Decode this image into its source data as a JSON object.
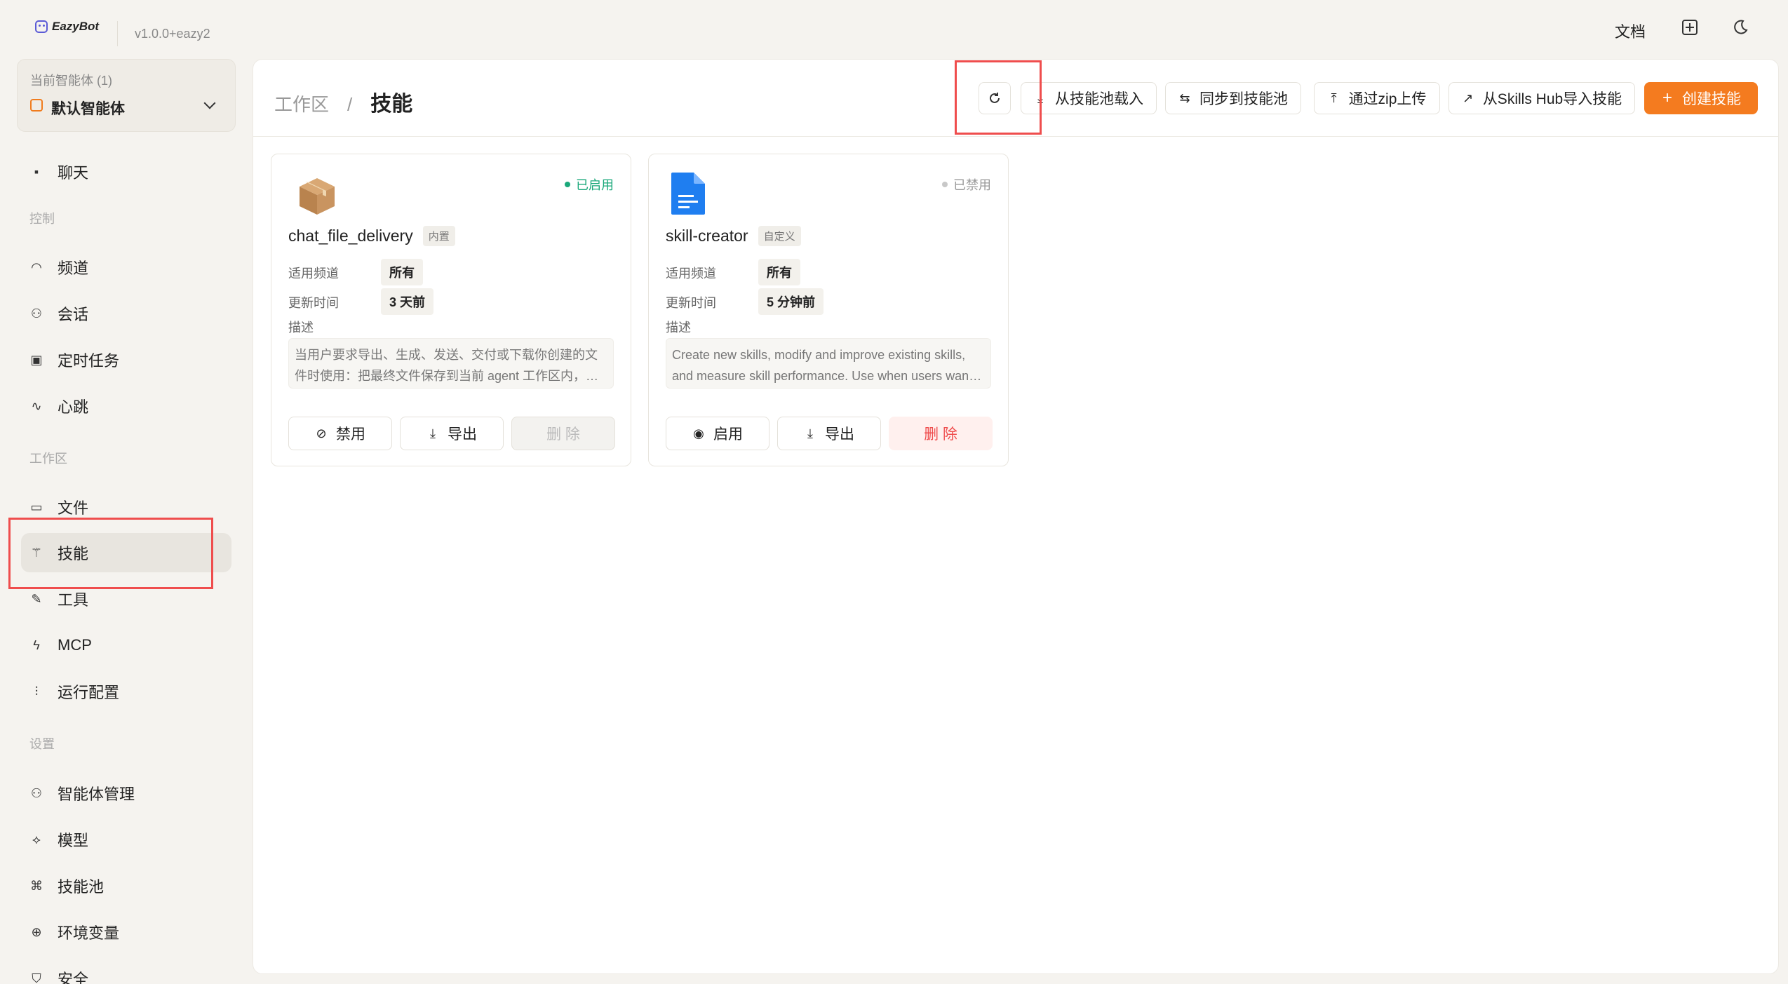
{
  "app": {
    "name": "EazyBot",
    "version": "v1.0.0+eazy2"
  },
  "topbar": {
    "docs_label": "文档",
    "layout_icon": "layout-icon",
    "theme_icon": "moon-icon"
  },
  "agent": {
    "label": "当前智能体 (1)",
    "name": "默认智能体"
  },
  "sidebar": {
    "chat": "聊天",
    "sections": {
      "control": "控制",
      "workspace": "工作区",
      "settings": "设置"
    },
    "control_items": [
      "频道",
      "会话",
      "定时任务",
      "心跳"
    ],
    "workspace_items": [
      "文件",
      "技能",
      "工具",
      "MCP",
      "运行配置"
    ],
    "settings_items": [
      "智能体管理",
      "模型",
      "技能池",
      "环境变量",
      "安全"
    ]
  },
  "breadcrumb": {
    "parent": "工作区",
    "separator": "/",
    "current": "技能"
  },
  "toolbar": {
    "load_from_pool": "从技能池载入",
    "sync_to_pool": "同步到技能池",
    "upload_zip": "通过zip上传",
    "import_hub": "从Skills Hub导入技能",
    "create": "创建技能"
  },
  "skills": [
    {
      "name": "chat_file_delivery",
      "tag": "内置",
      "status": "已启用",
      "status_color": "#1aa87a",
      "channel_label": "适用频道",
      "channel": "所有",
      "updated_label": "更新时间",
      "updated": "3 天前",
      "desc_label": "描述",
      "description": "当用户要求导出、生成、发送、交付或下载你创建的文件时使用：把最终文件保存到当前 agent 工作区内，并…",
      "toggle_label": "禁用",
      "export_label": "导出",
      "delete_label": "删 除"
    },
    {
      "name": "skill-creator",
      "tag": "自定义",
      "status": "已禁用",
      "status_color": "#bbbbbb",
      "channel_label": "适用频道",
      "channel": "所有",
      "updated_label": "更新时间",
      "updated": "5 分钟前",
      "desc_label": "描述",
      "description": "Create new skills, modify and improve existing skills, and measure skill performance. Use when users want to...",
      "toggle_label": "启用",
      "export_label": "导出",
      "delete_label": "删 除"
    }
  ],
  "colors": {
    "accent": "#f47b1f",
    "highlight": "#ef4d4d"
  }
}
